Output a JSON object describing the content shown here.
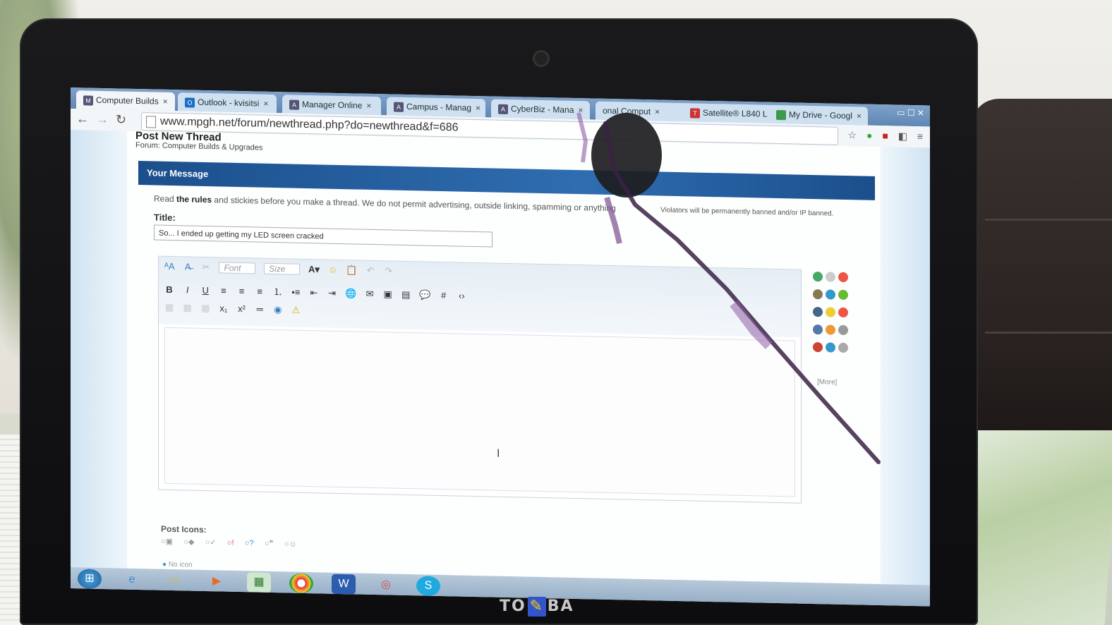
{
  "browser": {
    "tabs": [
      {
        "label": "Computer Builds",
        "icon": "M"
      },
      {
        "label": "Outlook - kvisitsi",
        "icon": "O"
      },
      {
        "label": "Manager Online",
        "icon": "A"
      },
      {
        "label": "Campus - Manag",
        "icon": "A"
      },
      {
        "label": "CyberBiz - Mana",
        "icon": "A"
      },
      {
        "label": "onal Comput",
        "icon": ""
      },
      {
        "label": "Satellite® L840 L",
        "icon": "T"
      },
      {
        "label": "My Drive - Googl",
        "icon": ""
      }
    ],
    "url": "www.mpgh.net/forum/newthread.php?do=newthread&f=686"
  },
  "page": {
    "title": "Post New Thread",
    "forum_prefix": "Forum:",
    "forum_name": "Computer Builds & Upgrades",
    "message_header": "Your Message",
    "rules_text_pre": "Read",
    "rules_link": "the rules",
    "rules_text_post": "and stickies before you make a thread. We do not permit advertising, outside linking, spamming or anything",
    "rules_text_tail": "Violators will be permanently banned and/or IP banned.",
    "title_label": "Title:",
    "title_value": "So... I ended up getting my LED screen cracked",
    "font_placeholder": "Font",
    "size_placeholder": "Size",
    "more_link": "[More]",
    "post_icons_label": "Post Icons:",
    "no_icon_label": "No icon"
  },
  "laptop": {
    "brand_left": "TO",
    "brand_right": "BA"
  },
  "colors": {
    "header_blue": "#1b4f8c",
    "crack_purple": "#6b3a7a"
  }
}
